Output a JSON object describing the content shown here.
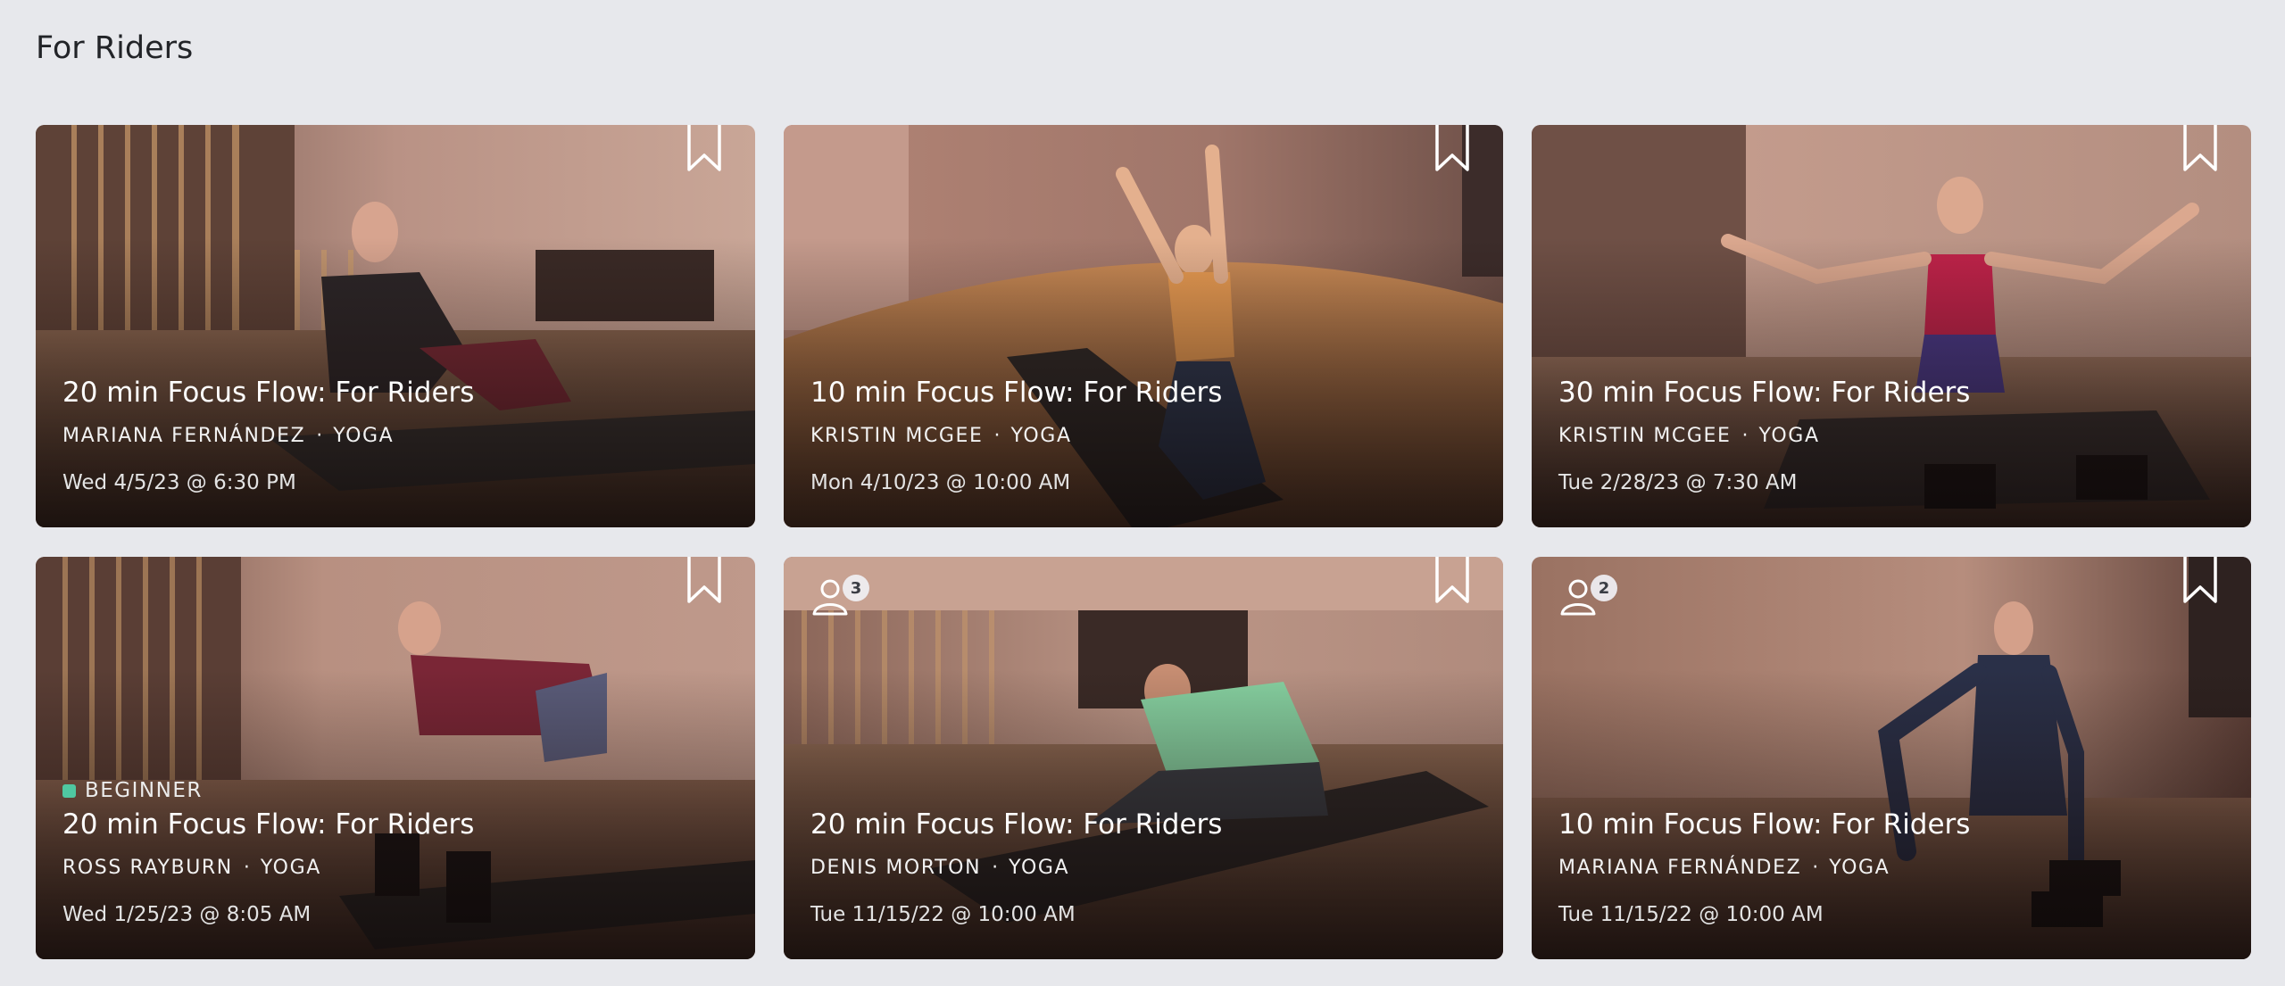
{
  "section": {
    "title": "For Riders"
  },
  "cards": [
    {
      "title": "20 min Focus Flow: For Riders",
      "instructor": "MARIANA FERNÁNDEZ",
      "separator": "·",
      "category": "YOGA",
      "date": "Wed 4/5/23 @ 6:30 PM",
      "bookmark_icon": "bookmark-icon"
    },
    {
      "title": "10 min Focus Flow: For Riders",
      "instructor": "KRISTIN MCGEE",
      "separator": "·",
      "category": "YOGA",
      "date": "Mon 4/10/23 @ 10:00 AM",
      "bookmark_icon": "bookmark-icon"
    },
    {
      "title": "30 min Focus Flow: For Riders",
      "instructor": "KRISTIN MCGEE",
      "separator": "·",
      "category": "YOGA",
      "date": "Tue 2/28/23 @ 7:30 AM",
      "bookmark_icon": "bookmark-icon"
    },
    {
      "level": "BEGINNER",
      "level_color": "#4fc8a1",
      "title": "20 min Focus Flow: For Riders",
      "instructor": "ROSS RAYBURN",
      "separator": "·",
      "category": "YOGA",
      "date": "Wed 1/25/23 @ 8:05 AM",
      "bookmark_icon": "bookmark-icon"
    },
    {
      "friends_count": "3",
      "friends_icon": "user-icon",
      "title": "20 min Focus Flow: For Riders",
      "instructor": "DENIS MORTON",
      "separator": "·",
      "category": "YOGA",
      "date": "Tue 11/15/22 @ 10:00 AM",
      "bookmark_icon": "bookmark-icon"
    },
    {
      "friends_count": "2",
      "friends_icon": "user-icon",
      "title": "10 min Focus Flow: For Riders",
      "instructor": "MARIANA FERNÁNDEZ",
      "separator": "·",
      "category": "YOGA",
      "date": "Tue 11/15/22 @ 10:00 AM",
      "bookmark_icon": "bookmark-icon"
    }
  ]
}
